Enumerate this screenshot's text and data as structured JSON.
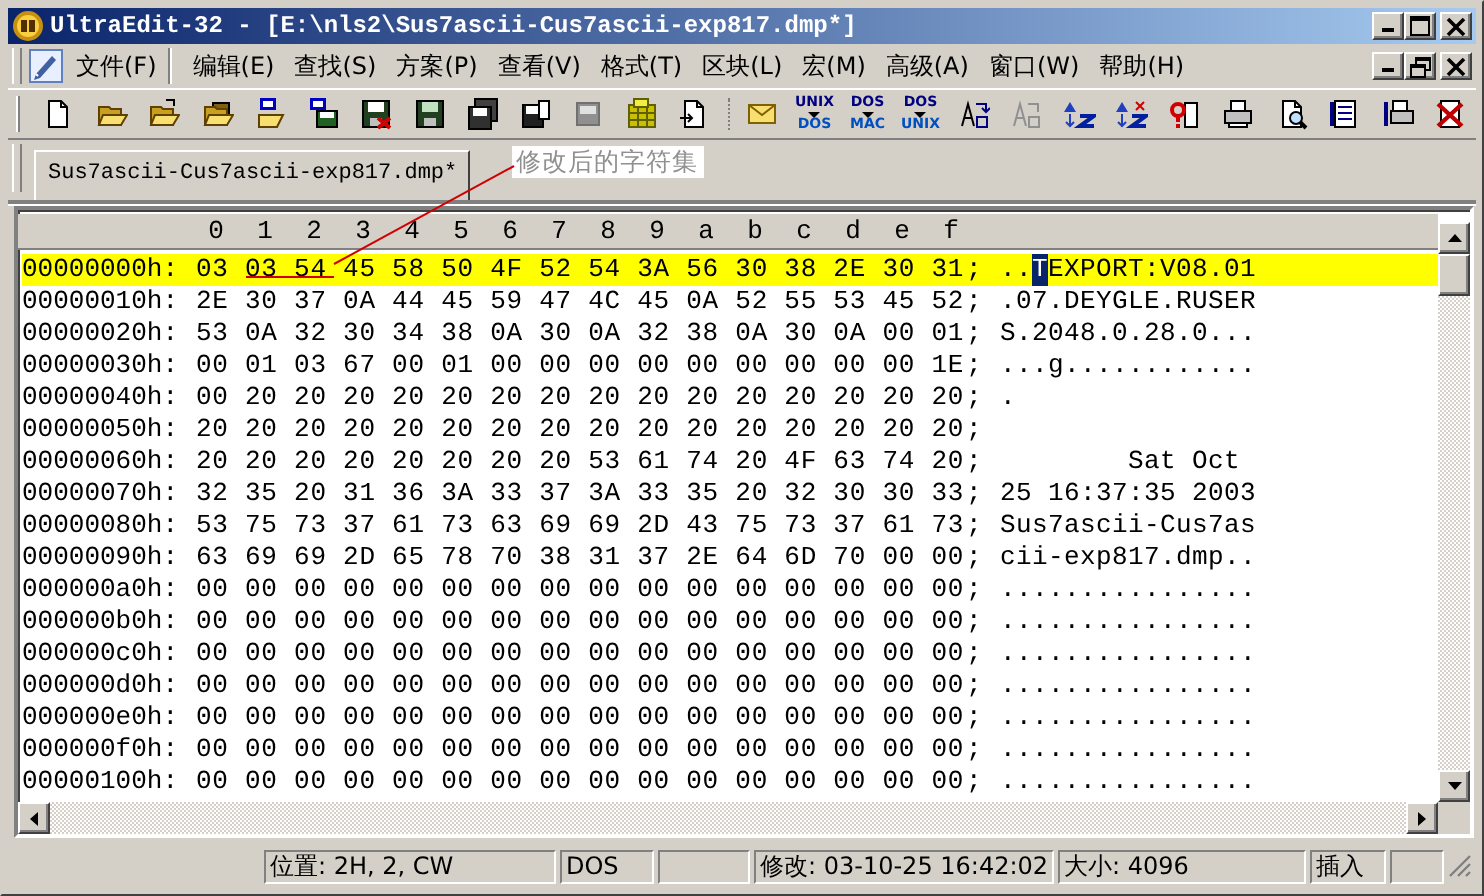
{
  "window": {
    "title": "UltraEdit-32 - [E:\\nls2\\Sus7ascii-Cus7ascii-exp817.dmp*]"
  },
  "menu": [
    "文件(F)",
    "编辑(E)",
    "查找(S)",
    "方案(P)",
    "查看(V)",
    "格式(T)",
    "区块(L)",
    "宏(M)",
    "高级(A)",
    "窗口(W)",
    "帮助(H)"
  ],
  "toolbar": {
    "convert_buttons": [
      {
        "top": "UNIX",
        "bottom": "DOS"
      },
      {
        "top": "DOS",
        "bottom": "MAC"
      },
      {
        "top": "DOS",
        "bottom": "UNIX"
      }
    ]
  },
  "tabs": [
    {
      "label": "Sus7ascii-Cus7ascii-exp817.dmp*",
      "selected": true
    }
  ],
  "annotation": {
    "text": "修改后的字符集"
  },
  "hex_view": {
    "columns": [
      "0",
      "1",
      "2",
      "3",
      "4",
      "5",
      "6",
      "7",
      "8",
      "9",
      "a",
      "b",
      "c",
      "d",
      "e",
      "f"
    ],
    "rows": [
      {
        "offset": "00000000h:",
        "hex": "03 03 54 45 58 50 4F 52 54 3A 56 30 38 2E 30 31",
        "separator": ";",
        "ascii": "..",
        "cursor": "T",
        "ascii_rest": "EXPORT:V08.01",
        "selected": true
      },
      {
        "offset": "00000010h:",
        "hex": "2E 30 37 0A 44 45 59 47 4C 45 0A 52 55 53 45 52",
        "separator": ";",
        "ascii": ".07.DEYGLE.RUSER",
        "selected": false
      },
      {
        "offset": "00000020h:",
        "hex": "53 0A 32 30 34 38 0A 30 0A 32 38 0A 30 0A 00 01",
        "separator": ";",
        "ascii": "S.2048.0.28.0...",
        "selected": false
      },
      {
        "offset": "00000030h:",
        "hex": "00 01 03 67 00 01 00 00 00 00 00 00 00 00 00 1E",
        "separator": ";",
        "ascii": "...g............",
        "selected": false
      },
      {
        "offset": "00000040h:",
        "hex": "00 20 20 20 20 20 20 20 20 20 20 20 20 20 20 20",
        "separator": ";",
        "ascii": ".",
        "selected": false
      },
      {
        "offset": "00000050h:",
        "hex": "20 20 20 20 20 20 20 20 20 20 20 20 20 20 20 20",
        "separator": ";",
        "selected": false
      },
      {
        "offset": "00000060h:",
        "hex": "20 20 20 20 20 20 20 20 53 61 74 20 4F 63 74 20",
        "separator": ";",
        "ascii": "        Sat Oct",
        "selected": false
      },
      {
        "offset": "00000070h:",
        "hex": "32 35 20 31 36 3A 33 37 3A 33 35 20 32 30 30 33",
        "separator": ";",
        "ascii": "25 16:37:35 2003",
        "selected": false
      },
      {
        "offset": "00000080h:",
        "hex": "53 75 73 37 61 73 63 69 69 2D 43 75 73 37 61 73",
        "separator": ";",
        "ascii": "Sus7ascii-Cus7as",
        "selected": false
      },
      {
        "offset": "00000090h:",
        "hex": "63 69 69 2D 65 78 70 38 31 37 2E 64 6D 70 00 00",
        "separator": ";",
        "ascii": "cii-exp817.dmp..",
        "selected": false
      },
      {
        "offset": "000000a0h:",
        "hex": "00 00 00 00 00 00 00 00 00 00 00 00 00 00 00 00",
        "separator": ";",
        "ascii": "................",
        "selected": false
      },
      {
        "offset": "000000b0h:",
        "hex": "00 00 00 00 00 00 00 00 00 00 00 00 00 00 00 00",
        "separator": ";",
        "ascii": "................",
        "selected": false
      },
      {
        "offset": "000000c0h:",
        "hex": "00 00 00 00 00 00 00 00 00 00 00 00 00 00 00 00",
        "separator": ";",
        "ascii": "................",
        "selected": false
      },
      {
        "offset": "000000d0h:",
        "hex": "00 00 00 00 00 00 00 00 00 00 00 00 00 00 00 00",
        "separator": ";",
        "ascii": "................",
        "selected": false
      },
      {
        "offset": "000000e0h:",
        "hex": "00 00 00 00 00 00 00 00 00 00 00 00 00 00 00 00",
        "separator": ";",
        "ascii": "................",
        "selected": false
      },
      {
        "offset": "000000f0h:",
        "hex": "00 00 00 00 00 00 00 00 00 00 00 00 00 00 00 00",
        "separator": ";",
        "ascii": "................",
        "selected": false
      },
      {
        "offset": "00000100h:",
        "hex": "00 00 00 00 00 00 00 00 00 00 00 00 00 00 00 00",
        "separator": ";",
        "ascii": "................",
        "selected": false
      }
    ]
  },
  "status_bar": [
    {
      "kind": "text",
      "text": "位置: 2H, 2, CW"
    },
    {
      "kind": "text",
      "text": "DOS"
    },
    {
      "kind": "blank"
    },
    {
      "kind": "text",
      "text": "修改: 03-10-25 16:42:02"
    },
    {
      "kind": "text",
      "text": "大小: 4096"
    },
    {
      "kind": "text",
      "text": "插入"
    },
    {
      "kind": "blank"
    }
  ]
}
